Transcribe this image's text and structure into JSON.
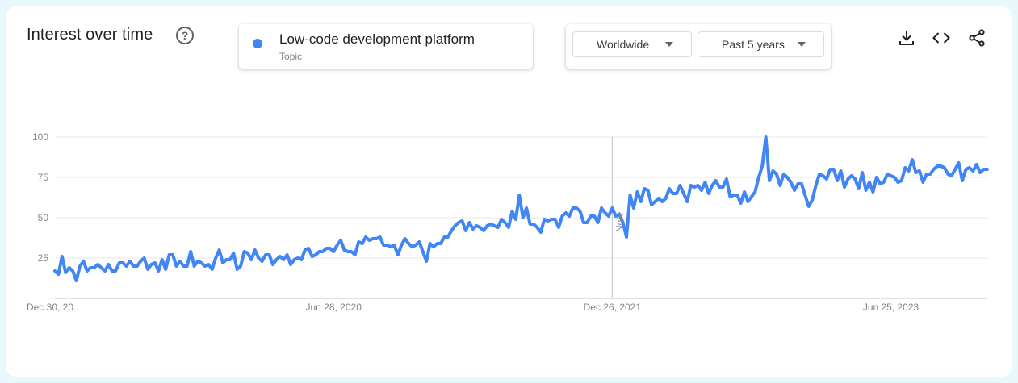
{
  "header": {
    "title": "Interest over time",
    "help_icon": "?"
  },
  "legend": {
    "term": "Low-code development platform",
    "term_type": "Topic",
    "color": "#4285f4"
  },
  "filters": {
    "region": "Worldwide",
    "time_range": "Past 5 years"
  },
  "toolbar": {
    "icons": [
      "download-icon",
      "embed-code-icon",
      "share-icon"
    ]
  },
  "chart_data": {
    "type": "line",
    "title": "",
    "xlabel": "",
    "ylabel": "",
    "ylim": [
      0,
      100
    ],
    "y_ticks": [
      25,
      50,
      75,
      100
    ],
    "x_tick_labels": [
      "Dec 30, 20…",
      "Jun 28, 2020",
      "Dec 26, 2021",
      "Jun 25, 2023"
    ],
    "note_label": "Note",
    "note_at_index": 156,
    "grid": true,
    "series": [
      {
        "name": "Low-code development platform",
        "color": "#4285f4",
        "values": [
          17,
          15,
          26,
          16,
          19,
          17,
          11,
          20,
          23,
          17,
          19,
          19,
          21,
          19,
          17,
          21,
          17,
          17,
          22,
          22,
          20,
          23,
          20,
          20,
          23,
          25,
          18,
          21,
          22,
          17,
          24,
          18,
          27,
          27,
          20,
          23,
          20,
          20,
          29,
          20,
          23,
          22,
          20,
          21,
          18,
          25,
          30,
          22,
          24,
          24,
          28,
          18,
          20,
          29,
          28,
          24,
          30,
          25,
          23,
          27,
          27,
          21,
          24,
          26,
          24,
          27,
          21,
          24,
          25,
          24,
          30,
          31,
          26,
          27,
          29,
          29,
          31,
          31,
          29,
          33,
          36,
          30,
          29,
          29,
          27,
          35,
          34,
          38,
          36,
          37,
          37,
          38,
          33,
          33,
          32,
          33,
          27,
          33,
          37,
          34,
          32,
          33,
          35,
          29,
          23,
          34,
          32,
          34,
          34,
          38,
          38,
          42,
          45,
          47,
          48,
          42,
          47,
          43,
          45,
          44,
          42,
          45,
          46,
          45,
          44,
          49,
          47,
          44,
          54,
          49,
          64,
          50,
          56,
          46,
          46,
          44,
          41,
          49,
          48,
          49,
          49,
          44,
          51,
          53,
          51,
          56,
          56,
          54,
          47,
          47,
          51,
          51,
          47,
          56,
          53,
          51,
          56,
          51,
          52,
          47,
          38,
          64,
          56,
          66,
          60,
          68,
          67,
          58,
          60,
          62,
          60,
          62,
          68,
          65,
          65,
          70,
          65,
          60,
          70,
          69,
          70,
          67,
          72,
          65,
          70,
          73,
          69,
          69,
          74,
          63,
          64,
          64,
          59,
          66,
          60,
          63,
          66,
          75,
          82,
          100,
          73,
          79,
          77,
          70,
          77,
          75,
          72,
          67,
          71,
          71,
          64,
          57,
          61,
          70,
          77,
          76,
          74,
          80,
          80,
          73,
          79,
          69,
          74,
          76,
          74,
          68,
          78,
          67,
          72,
          66,
          75,
          71,
          72,
          77,
          76,
          75,
          72,
          73,
          81,
          79,
          86,
          78,
          79,
          72,
          77,
          77,
          80,
          82,
          82,
          81,
          77,
          76,
          80,
          84,
          73,
          80,
          81,
          79,
          83,
          78,
          80,
          80
        ]
      }
    ]
  }
}
